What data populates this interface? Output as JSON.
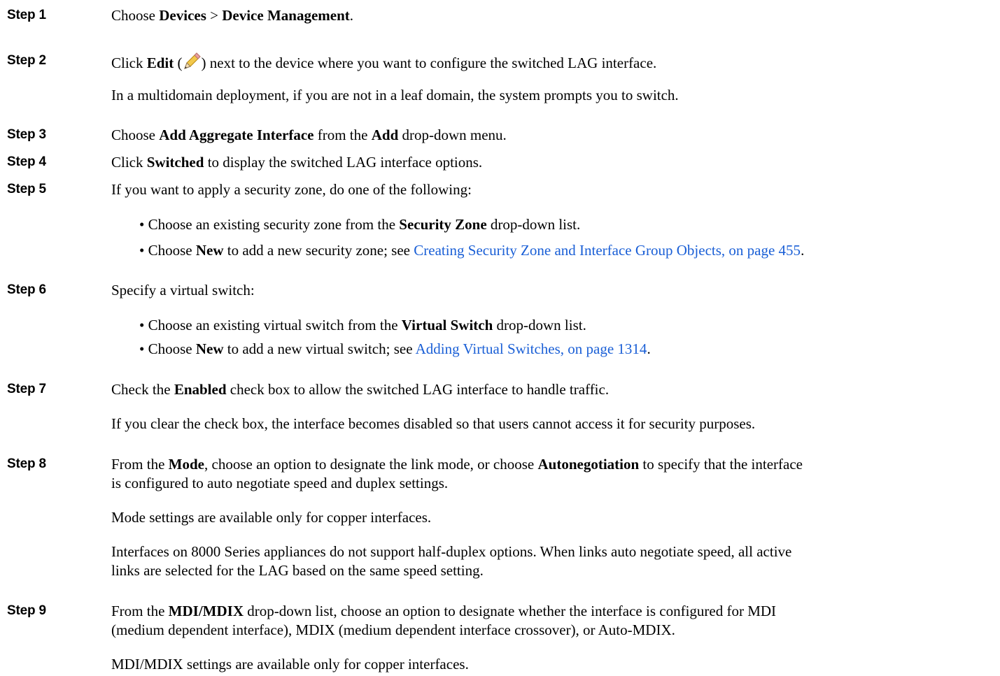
{
  "steps": [
    {
      "label": "Step 1",
      "lines": [
        {
          "pre": "Choose ",
          "b1": "Devices",
          "mid": " > ",
          "b2": "Device Management",
          "post": "."
        }
      ]
    },
    {
      "label": "Step 2",
      "main": {
        "pre": "Click ",
        "b1": "Edit",
        "open": " (",
        "close": ") next to the device where you want to configure the switched LAG interface."
      },
      "note": "In a multidomain deployment, if you are not in a leaf domain, the system prompts you to switch."
    },
    {
      "label": "Step 3",
      "main": {
        "pre": "Choose ",
        "b1": "Add Aggregate Interface",
        "mid": " from the ",
        "b2": "Add",
        "post": " drop-down menu."
      }
    },
    {
      "label": "Step 4",
      "main": {
        "pre": "Click ",
        "b1": "Switched",
        "post": " to display the switched LAG interface options."
      }
    },
    {
      "label": "Step 5",
      "main": "If you want to apply a security zone, do one of the following:",
      "bullets": [
        {
          "pre": "• Choose an existing security zone from the ",
          "b1": "Security Zone",
          "post": " drop-down list."
        },
        {
          "pre": "• Choose ",
          "b1": "New",
          "mid": " to add a new security zone; see ",
          "link": "Creating Security Zone and Interface Group Objects, on page 455",
          "post": "."
        }
      ]
    },
    {
      "label": "Step 6",
      "main": "Specify a virtual switch:",
      "bullets": [
        {
          "pre": "• Choose an existing virtual switch from the ",
          "b1": "Virtual Switch",
          "post": " drop-down list."
        },
        {
          "pre": "• Choose ",
          "b1": "New",
          "mid": " to add a new virtual switch; see ",
          "link": "Adding Virtual Switches, on page 1314",
          "post": "."
        }
      ]
    },
    {
      "label": "Step 7",
      "main": {
        "pre": "Check the ",
        "b1": "Enabled",
        "post": " check box to allow the switched LAG interface to handle traffic."
      },
      "note": "If you clear the check box, the interface becomes disabled so that users cannot access it for security purposes."
    },
    {
      "label": "Step 8",
      "main": {
        "pre": "From the ",
        "b1": "Mode",
        "mid": ", choose an option to designate the link mode, or choose ",
        "b2": "Autonegotiation",
        "post": " to specify that the interface",
        "line2": "is configured to auto negotiate speed and duplex settings."
      },
      "note": "Mode settings are available only for copper interfaces.",
      "note2_line1": "Interfaces on 8000 Series appliances do not support half-duplex options. When links auto negotiate speed, all active",
      "note2_line2": "links are selected for the LAG based on the same speed setting."
    },
    {
      "label": "Step 9",
      "main": {
        "pre": "From the ",
        "b1": "MDI/MDIX",
        "post": " drop-down list, choose an option to designate whether the interface is configured for MDI",
        "line2": "(medium dependent interface), MDIX (medium dependent interface crossover), or Auto-MDIX."
      },
      "note": "MDI/MDIX settings are available only for copper interfaces."
    }
  ]
}
